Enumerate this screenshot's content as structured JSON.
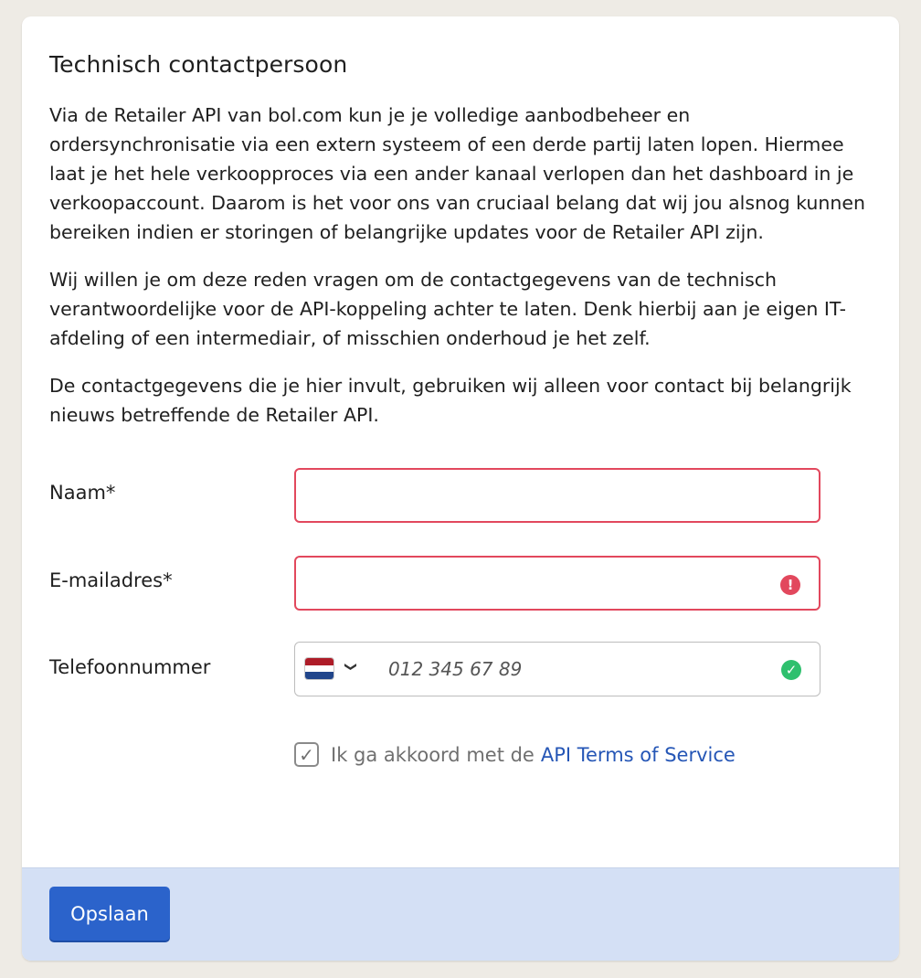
{
  "card": {
    "title": "Technisch contactpersoon",
    "paragraphs": [
      "Via de Retailer API van bol.com kun je je volledige aanbodbeheer en ordersynchronisatie via een extern systeem of een derde partij laten lopen. Hiermee laat je het hele verkoopproces via een ander kanaal verlopen dan het dashboard in je verkoopaccount. Daarom is het voor ons van cruciaal belang dat wij jou alsnog kunnen bereiken indien er storingen of belangrijke updates voor de Retailer API zijn.",
      "Wij willen je om deze reden vragen om de contactgegevens van de technisch verantwoordelijke voor de API-koppeling achter te laten. Denk hierbij aan je eigen IT-afdeling of een intermediair, of misschien onderhoud je het zelf.",
      "De contactgegevens die je hier invult, gebruiken wij alleen voor contact bij belangrijk nieuws betreffende de Retailer API."
    ]
  },
  "form": {
    "name": {
      "label": "Naam*",
      "value": ""
    },
    "email": {
      "label": "E-mailadres*",
      "value": "",
      "status_icon": "error-icon"
    },
    "phone": {
      "label": "Telefoonnummer",
      "placeholder": "012 345 67 89",
      "value": "",
      "country_icon": "netherlands-flag-icon",
      "status_icon": "check-icon"
    },
    "agree": {
      "checked": true,
      "text": "Ik ga akkoord met de",
      "link_text": "API Terms of Service"
    }
  },
  "footer": {
    "save_label": "Opslaan"
  },
  "colors": {
    "page_bg": "#eeebe5",
    "error": "#e2485d",
    "success": "#2fc06e",
    "link": "#2556b6",
    "button": "#2b63cb",
    "footer_bg": "#d4e0f5"
  }
}
